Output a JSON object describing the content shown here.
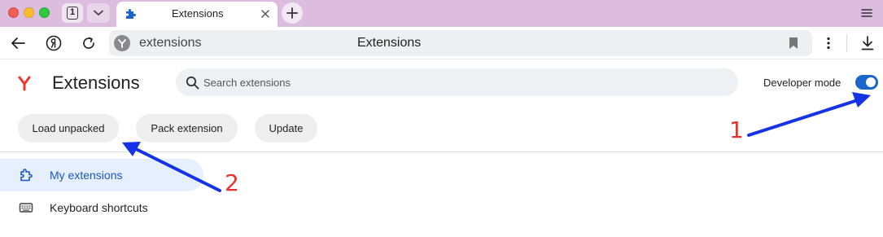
{
  "browser": {
    "tab_count": "1",
    "tab_title": "Extensions",
    "address_text": "extensions",
    "address_title": "Extensions"
  },
  "header": {
    "title": "Extensions",
    "search_placeholder": "Search extensions",
    "developer_mode_label": "Developer mode",
    "developer_mode_on": true
  },
  "actions": {
    "load_unpacked": "Load unpacked",
    "pack_extension": "Pack extension",
    "update": "Update"
  },
  "sidebar": {
    "items": [
      {
        "label": "My extensions",
        "icon": "puzzle-icon",
        "selected": true
      },
      {
        "label": "Keyboard shortcuts",
        "icon": "keyboard-icon",
        "selected": false
      }
    ]
  },
  "annotations": {
    "marker_1": "1",
    "marker_2": "2"
  },
  "colors": {
    "tabstrip": "#dcbcdf",
    "accent": "#1a66cc",
    "selected_nav_bg": "#e6effd",
    "arrow": "#1432e6",
    "marker": "#e8322c"
  }
}
